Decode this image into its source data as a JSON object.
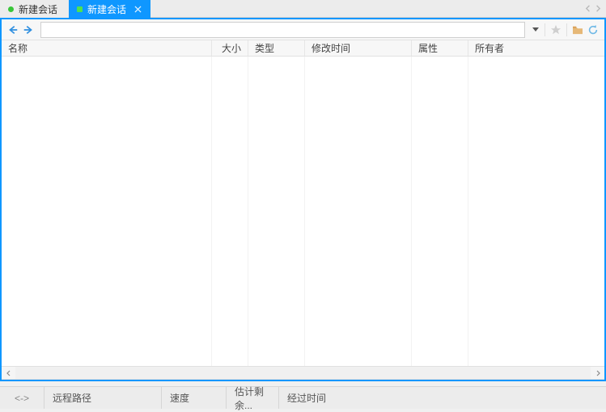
{
  "tabs": {
    "items": [
      {
        "label": "新建会话",
        "active": false
      },
      {
        "label": "新建会话",
        "active": true
      }
    ]
  },
  "toolbar": {
    "path_value": ""
  },
  "columns": {
    "name": "名称",
    "size": "大小",
    "type": "类型",
    "mtime": "修改时间",
    "attr": "属性",
    "owner": "所有者"
  },
  "files": [],
  "statusbar": {
    "transfer_indicator": "<->",
    "remote_path_label": "远程路径",
    "speed_label": "速度",
    "eta_label": "估计剩余...",
    "elapsed_label": "经过时间"
  }
}
